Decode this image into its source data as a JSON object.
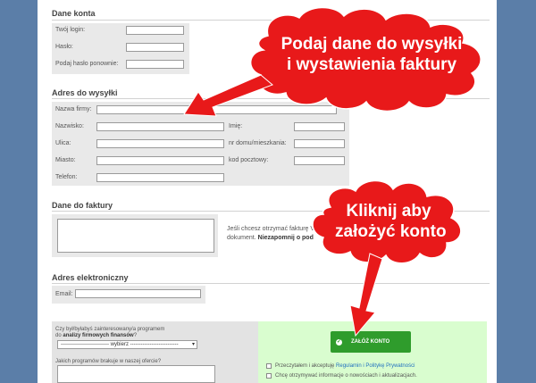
{
  "account": {
    "title": "Dane konta",
    "login_label": "Twój login:",
    "password_label": "Hasło:",
    "password_repeat_label": "Podaj hasło ponownie:"
  },
  "shipping": {
    "title": "Adres do wysyłki",
    "company_label": "Nazwa firmy:",
    "surname_label": "Nazwisko:",
    "name_label": "Imię:",
    "street_label": "Ulica:",
    "house_label": "nr domu/mieszkania:",
    "city_label": "Miasto:",
    "postcode_label": "kod pocztowy:",
    "phone_label": "Telefon:"
  },
  "invoice": {
    "title": "Dane do faktury",
    "note_part1": "Jeśli chcesz otrzymać fakturę V",
    "note_part2": "dokument.",
    "note_bold": "Niezapomnij o pod"
  },
  "electronic": {
    "title": "Adres elektroniczny",
    "email_label": "Email:"
  },
  "affiliate": {
    "question_line1": "Czy był/byłabyś zainteresowany/a programem",
    "question_line2_prefix": "do",
    "question_line2_bold": "analizy firmowych finansów",
    "question_line2_suffix": "?",
    "select_value": "--------------------------- wybierz ---------------------------",
    "missing_question": "Jakich programów brakuje w naszej ofercie?"
  },
  "submit": {
    "button_label": "ZAŁÓŻ KONTO",
    "terms_prefix": "Przeczytałem i akceptuję",
    "terms_link1": "Regulamin",
    "terms_and": "i",
    "terms_link2": "Politykę Prywatności",
    "newsletter": "Chcę otrzymywać informacje o nowościach i aktualizacjach."
  },
  "callouts": {
    "top_line1": "Podaj dane do wysyłki",
    "top_line2": "i wystawienia faktury",
    "bottom_line1": "Kliknij aby",
    "bottom_line2": "założyć konto"
  },
  "colors": {
    "cloud": "#e8191a",
    "arrow": "#e8191a",
    "button": "#2f9c2c",
    "green_zone": "#d9fdcf",
    "page_bg": "#5b7ea8"
  }
}
